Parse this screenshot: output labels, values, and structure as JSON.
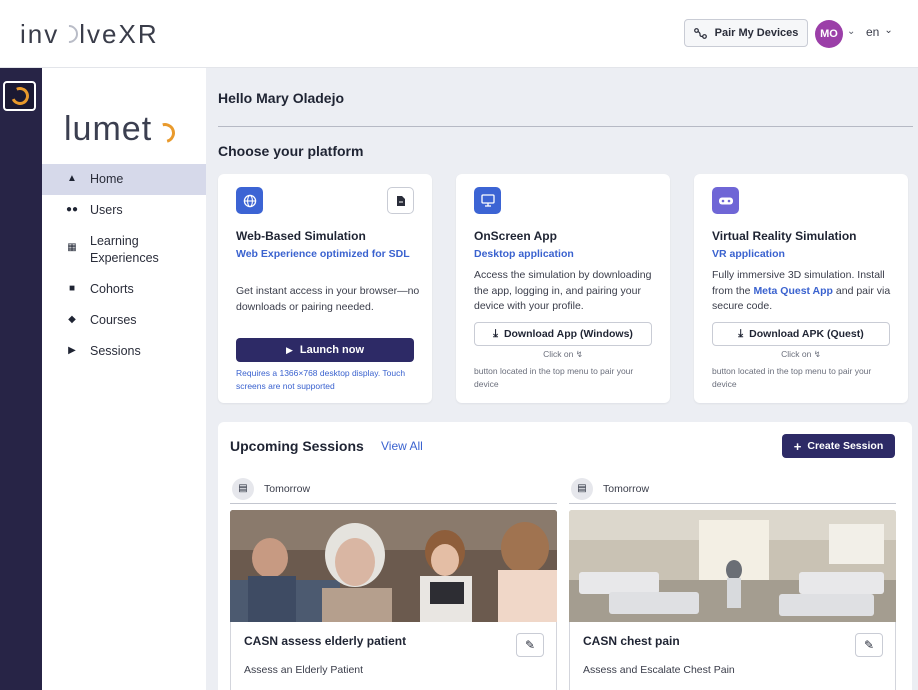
{
  "header": {
    "brand": "invxlveXR",
    "brand_prefix": "inv",
    "brand_suffix": "lveXR",
    "pair_button": "Pair My Devices",
    "avatar_initials": "MO",
    "language": "en"
  },
  "sidebar": {
    "logo_text": "lumet",
    "items": [
      {
        "label": "Home",
        "icon": "home-icon",
        "active": true
      },
      {
        "label": "Users",
        "icon": "users-icon",
        "active": false
      },
      {
        "label": "Learning Experiences",
        "icon": "grid-icon",
        "active": false
      },
      {
        "label": "Cohorts",
        "icon": "book-icon",
        "active": false
      },
      {
        "label": "Courses",
        "icon": "graduation-cap-icon",
        "active": false
      },
      {
        "label": "Sessions",
        "icon": "play-icon",
        "active": false
      }
    ]
  },
  "main": {
    "greeting": "Hello Mary Oladejo",
    "platform_title": "Choose your platform",
    "cards": [
      {
        "title": "Web-Based Simulation",
        "subtitle": "Web Experience optimized for SDL",
        "description": "Get instant access in your browser—no downloads or pairing needed.",
        "button": "Launch now",
        "note": "Requires a 1366×768 desktop display. Touch screens are not supported"
      },
      {
        "title": "OnScreen App",
        "subtitle": "Desktop application",
        "description": "Access the simulation by downloading the app, logging in, and pairing your device with your profile.",
        "button": "Download App (Windows)",
        "click_on": "Click on",
        "pair_note": "button located in the top menu to pair your device"
      },
      {
        "title": "Virtual Reality Simulation",
        "subtitle": "VR application",
        "description_before": "Fully immersive 3D simulation. Install from the ",
        "description_link": "Meta Quest App",
        "description_after": " and pair via secure code.",
        "button": "Download APK (Quest)",
        "click_on": "Click on",
        "pair_note": "button located in the top menu to pair your device"
      }
    ],
    "upcoming": {
      "title": "Upcoming Sessions",
      "view_all": "View All",
      "create_button": "Create Session",
      "sessions": [
        {
          "when": "Tomorrow",
          "name": "CASN assess elderly patient",
          "description": "Assess an Elderly Patient"
        },
        {
          "when": "Tomorrow",
          "name": "CASN chest pain",
          "description": "Assess and Escalate Chest Pain"
        }
      ]
    }
  },
  "colors": {
    "accent": "#2d2a66",
    "link": "#3a62cf",
    "rail": "#272446",
    "logo_orange": "#e99a2c",
    "avatar": "#9b3fa8",
    "active_nav": "#d6d9ea"
  }
}
